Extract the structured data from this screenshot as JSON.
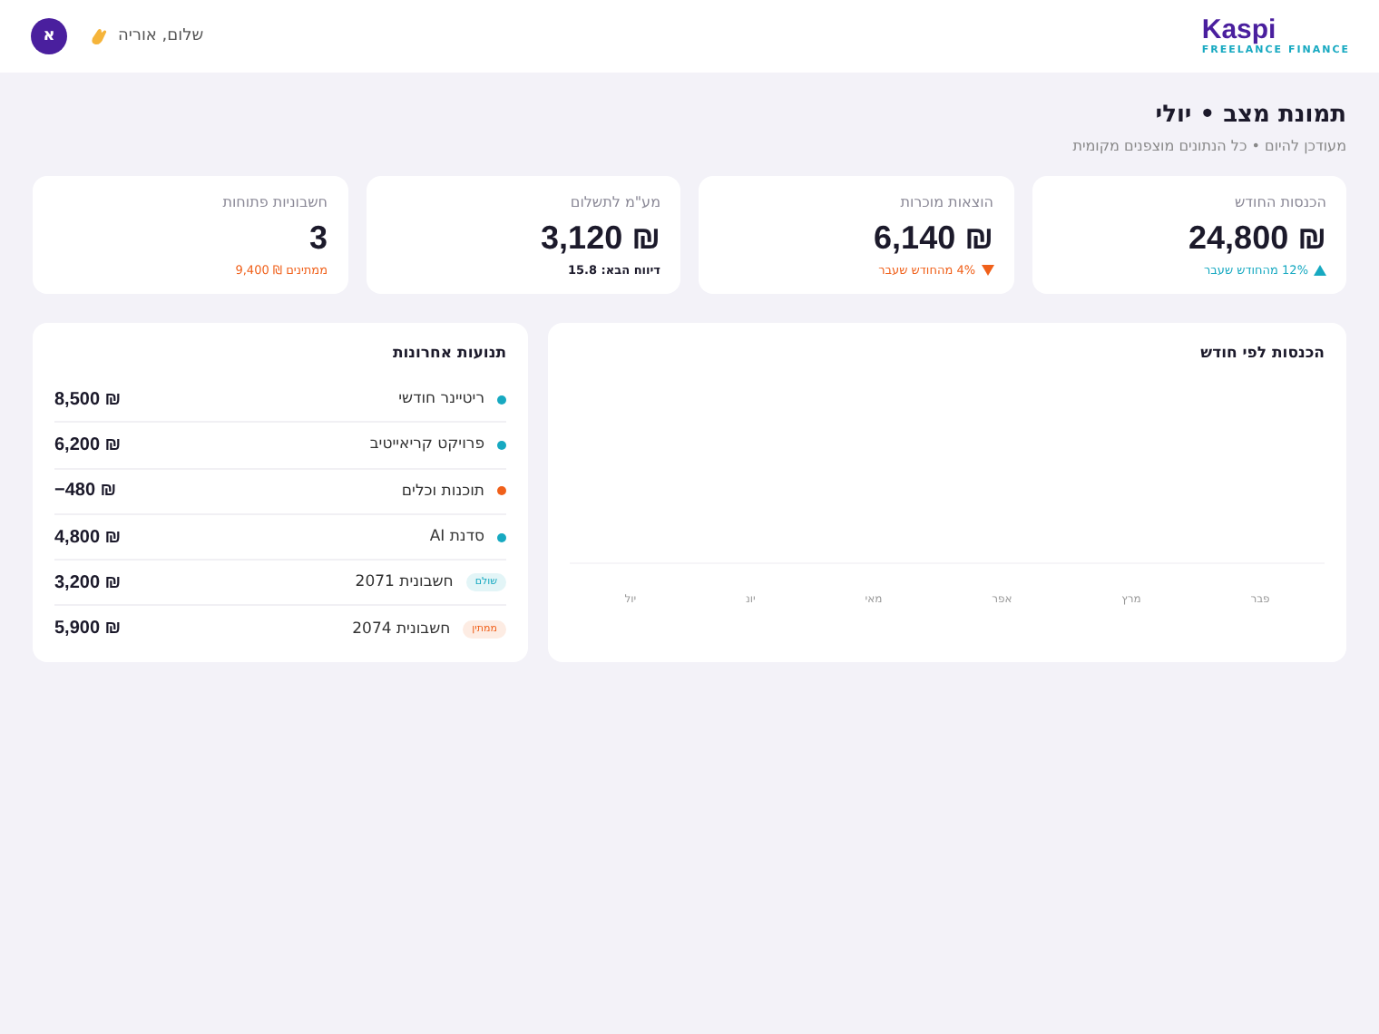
{
  "header": {
    "logo": "Kaspi",
    "tagline": "FREELANCE FINANCE",
    "greeting": "שלום, אוריה",
    "avatar": "א"
  },
  "page": {
    "title": "תמונת מצב • יולי",
    "subtitle": "מעודכן להיום • כל הנתונים מוצפנים מקומית"
  },
  "kpis": [
    {
      "label": "הכנסות החודש",
      "value": "24,800 ₪",
      "note": "12% מהחודש שעבר",
      "kind": "up"
    },
    {
      "label": "הוצאות מוכרות",
      "value": "6,140 ₪",
      "note": "4% מהחודש שעבר",
      "kind": "down"
    },
    {
      "label": "מע\"מ לתשלום",
      "value": "3,120 ₪",
      "note": "דיווח הבא: 15.8",
      "kind": "plain"
    },
    {
      "label": "חשבוניות פתוחות",
      "value": "3",
      "note": "ממתינים ₪ 9,400",
      "kind": "warn"
    }
  ],
  "chart": {
    "title": "הכנסות לפי חודש",
    "months": [
      "פבר",
      "מרץ",
      "אפר",
      "מאי",
      "יונ",
      "יול"
    ]
  },
  "transactions": {
    "title": "תנועות אחרונות",
    "items": [
      {
        "kind": "dot",
        "color": "#17a9c1",
        "name": "ריטיינר חודשי",
        "amount": "8,500 ₪"
      },
      {
        "kind": "dot",
        "color": "#17a9c1",
        "name": "פרויקט קריאייטיב",
        "amount": "6,200 ₪"
      },
      {
        "kind": "dot",
        "color": "#f0601a",
        "name": "תוכנות וכלים",
        "amount": "−480 ₪"
      },
      {
        "kind": "dot",
        "color": "#17a9c1",
        "name": "סדנת AI",
        "amount": "4,800 ₪"
      },
      {
        "kind": "badge",
        "color": "#17a9c1",
        "badge": "שולם",
        "name": "חשבונית 2071",
        "amount": "3,200 ₪"
      },
      {
        "kind": "badge",
        "color": "#f0601a",
        "badge": "ממתין",
        "name": "חשבונית 2074",
        "amount": "5,900 ₪"
      }
    ]
  }
}
